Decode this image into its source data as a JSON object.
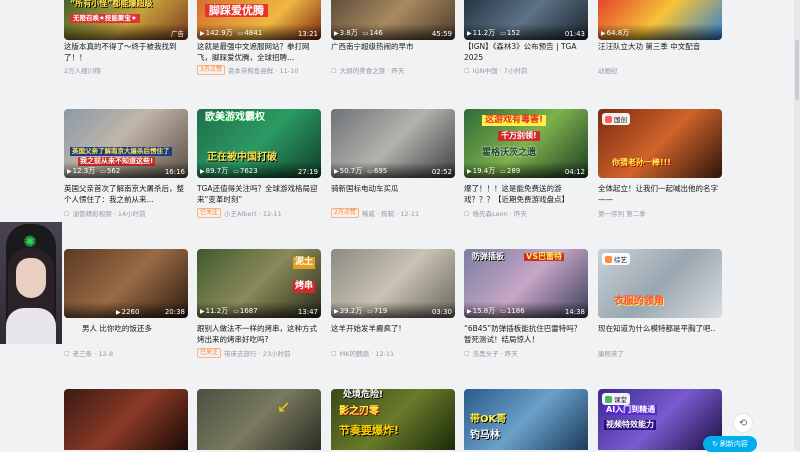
{
  "cards": [
    {
      "id": "r1c1",
      "stats": [
        "",
        ""
      ],
      "duration": "",
      "ad_label": "广告",
      "title": "这版本真的不得了～终于被我找到了！！",
      "meta_prefix": "",
      "meta": "2万人搜川翔",
      "badge": "",
      "caption": [
        "“所有小怪”都能爆超级",
        "无限召唤★技能聚宝★"
      ]
    },
    {
      "id": "r1c2",
      "stats": [
        "142.9万",
        "4841"
      ],
      "duration": "13:21",
      "ad_label": "",
      "title": "这就是最强中文遮服网站？拳打网飞，脚踩爱优腾，全球招聘...",
      "badge": "3万点赞",
      "meta": "资本带鳄鱼县鲜 · 11-10",
      "caption": [
        "脚踩爱优腾"
      ]
    },
    {
      "id": "r1c3",
      "stats": [
        "3.8万",
        "146"
      ],
      "duration": "45:59",
      "ad_label": "",
      "title": "广西南宁超级热闹的早市",
      "badge": "",
      "meta": "大胡的美食之旅 · 昨天",
      "caption": []
    },
    {
      "id": "r1c4",
      "stats": [
        "11.2万",
        "152"
      ],
      "duration": "01:43",
      "ad_label": "",
      "title": "【IGN】《森林3》公布预告 | TGA 2025",
      "badge": "",
      "meta": "IGN中国 · 7小时前",
      "caption": []
    },
    {
      "id": "r1c5",
      "stats": [
        "64.8万",
        ""
      ],
      "duration": "",
      "ad_label": "",
      "title": "汪汪队立大功 第三季 中文配音",
      "badge": "",
      "meta": "动画纪",
      "caption": []
    },
    {
      "id": "r2c1",
      "stats": [
        "12.3万",
        "562"
      ],
      "duration": "16:16",
      "ad_label": "",
      "title": "英国父亲首次了解南京大屠杀后，整个人愣住了：我之前从来...",
      "badge": "",
      "meta": "油管精彩视频 · 14小时前",
      "caption": [
        "英国父亲了解南京大屠杀后愣住了",
        "我之前从来不知道这些!"
      ]
    },
    {
      "id": "r2c2",
      "stats": [
        "89.7万",
        "7623"
      ],
      "duration": "27:19",
      "ad_label": "",
      "title": "TGA还值得关注吗？全球游戏格局迎来“变革时刻”",
      "badge": "已关注",
      "meta": "小王Albert · 12-11",
      "caption": [
        "欧美游戏霸权",
        "正在被中国打破"
      ]
    },
    {
      "id": "r2c3",
      "stats": [
        "50.7万",
        "695"
      ],
      "duration": "02:52",
      "ad_label": "",
      "title": "骑新国标电动车买瓜",
      "badge": "2万点赞",
      "meta": "稀威 · 狗鞘 · 12-11",
      "caption": []
    },
    {
      "id": "r2c4",
      "stats": [
        "19.4万",
        "289"
      ],
      "duration": "04:12",
      "ad_label": "",
      "title": "爆了！！！这是能免费送的游戏？？？【近期免费游戏盘点】",
      "badge": "",
      "meta": "杨先森Leon · 昨天",
      "caption": [
        "这游戏有毒害!",
        "千万别领!",
        "霍格沃茨之遗"
      ]
    },
    {
      "id": "r2c5",
      "stats": [
        "",
        ""
      ],
      "duration": "",
      "ad_label": "",
      "tag": "国创",
      "title": "全体起立！让我们一起喊出他的名字——",
      "badge": "",
      "meta": "第一序列 第二季",
      "caption": [
        "你猜老孙一棒!!!"
      ]
    },
    {
      "id": "r3c1",
      "stats": [
        "2260",
        ""
      ],
      "duration": "20:38",
      "ad_label": "",
      "title": "男人 比你吃的饭还多",
      "badge": "",
      "meta": "老三条 · 12-8",
      "caption": []
    },
    {
      "id": "r3c2",
      "stats": [
        "11.2万",
        "1687"
      ],
      "duration": "13:47",
      "ad_label": "",
      "title": "跟别人做法不一样的烤串，这种方式烤出来的烤串好吃吗?",
      "badge": "已关注",
      "meta": "带床去旅行 · 23小时前",
      "caption": [
        "泥土",
        "烤串"
      ]
    },
    {
      "id": "r3c3",
      "stats": [
        "39.2万",
        "719"
      ],
      "duration": "03:30",
      "ad_label": "",
      "title": "这羊开始发羊癫疯了!",
      "badge": "",
      "meta": "MK的鹦鹉 · 12-11",
      "caption": []
    },
    {
      "id": "r3c4",
      "stats": [
        "15.8万",
        "1186"
      ],
      "duration": "14:38",
      "ad_label": "",
      "title": "“6B45”防弹插板能抗住巴雷特吗？暂死测试！结局惊人！",
      "badge": "",
      "meta": "浩黑头子 · 昨天",
      "caption": [
        "防弹插板",
        "VS巴雷特"
      ]
    },
    {
      "id": "r3c5",
      "stats": [
        "",
        ""
      ],
      "duration": "",
      "ad_label": "",
      "tag": "综艺",
      "title": "现在知道为什么模特都是平胸了吧..",
      "badge": "",
      "meta": "康熙来了",
      "caption": [
        "衣服的领角"
      ]
    },
    {
      "id": "r4c1",
      "stats": [
        "",
        ""
      ],
      "duration": "",
      "ad_label": "",
      "title": "",
      "badge": "",
      "meta": "",
      "caption": []
    },
    {
      "id": "r4c2",
      "stats": [
        "",
        ""
      ],
      "duration": "",
      "ad_label": "",
      "title": "",
      "badge": "",
      "meta": "",
      "caption": []
    },
    {
      "id": "r4c3",
      "stats": [
        "",
        ""
      ],
      "duration": "",
      "ad_label": "",
      "title": "",
      "badge": "",
      "meta": "",
      "caption": [
        "处境危险!",
        "影之刃零",
        "节奏要爆炸!"
      ]
    },
    {
      "id": "r4c4",
      "stats": [
        "",
        ""
      ],
      "duration": "",
      "ad_label": "",
      "title": "",
      "badge": "",
      "meta": "",
      "caption": [
        "带OK哥",
        "钓马林"
      ]
    },
    {
      "id": "r4c5",
      "stats": [
        "",
        ""
      ],
      "duration": "",
      "ad_label": "",
      "tag": "课堂",
      "title": "",
      "badge": "",
      "meta": "",
      "caption": [
        "AI入门到精通",
        "视频特效能力"
      ]
    }
  ],
  "floating": {
    "refresh_label": "刷新内容",
    "top_icon": "back-to-top-icon"
  },
  "colors": {
    "accent": "#00aeec",
    "badge_orange": "#ff7f24",
    "meta_grey": "#9499a0"
  }
}
